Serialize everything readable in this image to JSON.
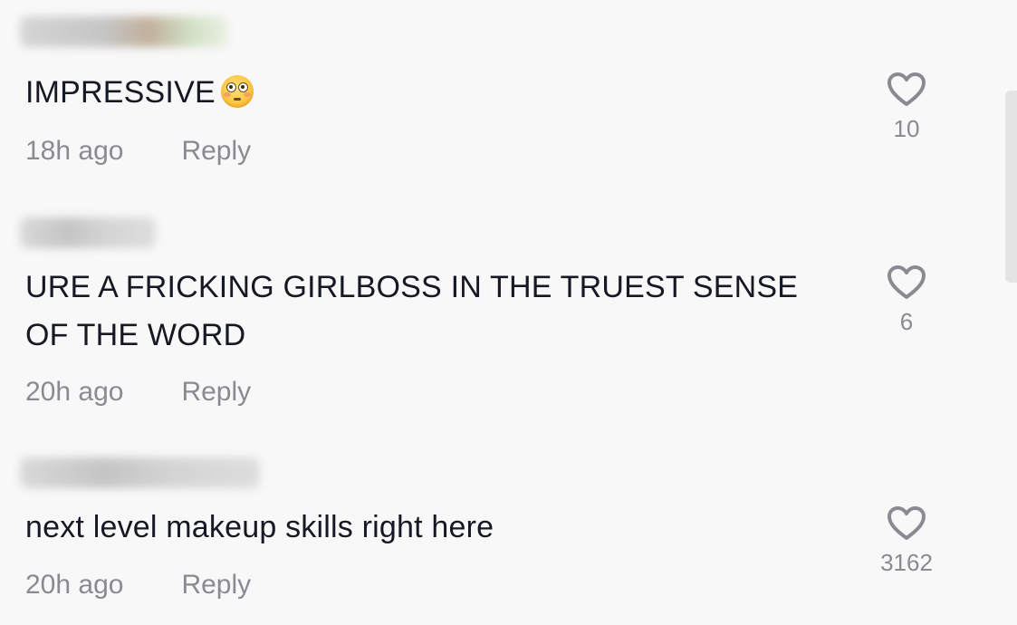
{
  "comments": [
    {
      "username": "",
      "text": "IMPRESSIVE",
      "emoji": "flushed-face-emoji",
      "time": "18h ago",
      "reply_label": "Reply",
      "likes": "10"
    },
    {
      "username": "",
      "text": "URE A FRICKING GIRLBOSS IN THE TRUEST SENSE OF THE WORD",
      "time": "20h ago",
      "reply_label": "Reply",
      "likes": "6"
    },
    {
      "username": "",
      "text": "next level makeup skills right here",
      "time": "20h ago",
      "reply_label": "Reply",
      "likes": "3162"
    }
  ],
  "icons": {
    "like": "heart-outline-icon"
  },
  "colors": {
    "background": "#f8f8f8",
    "text": "#161823",
    "muted": "#8a8b91"
  }
}
